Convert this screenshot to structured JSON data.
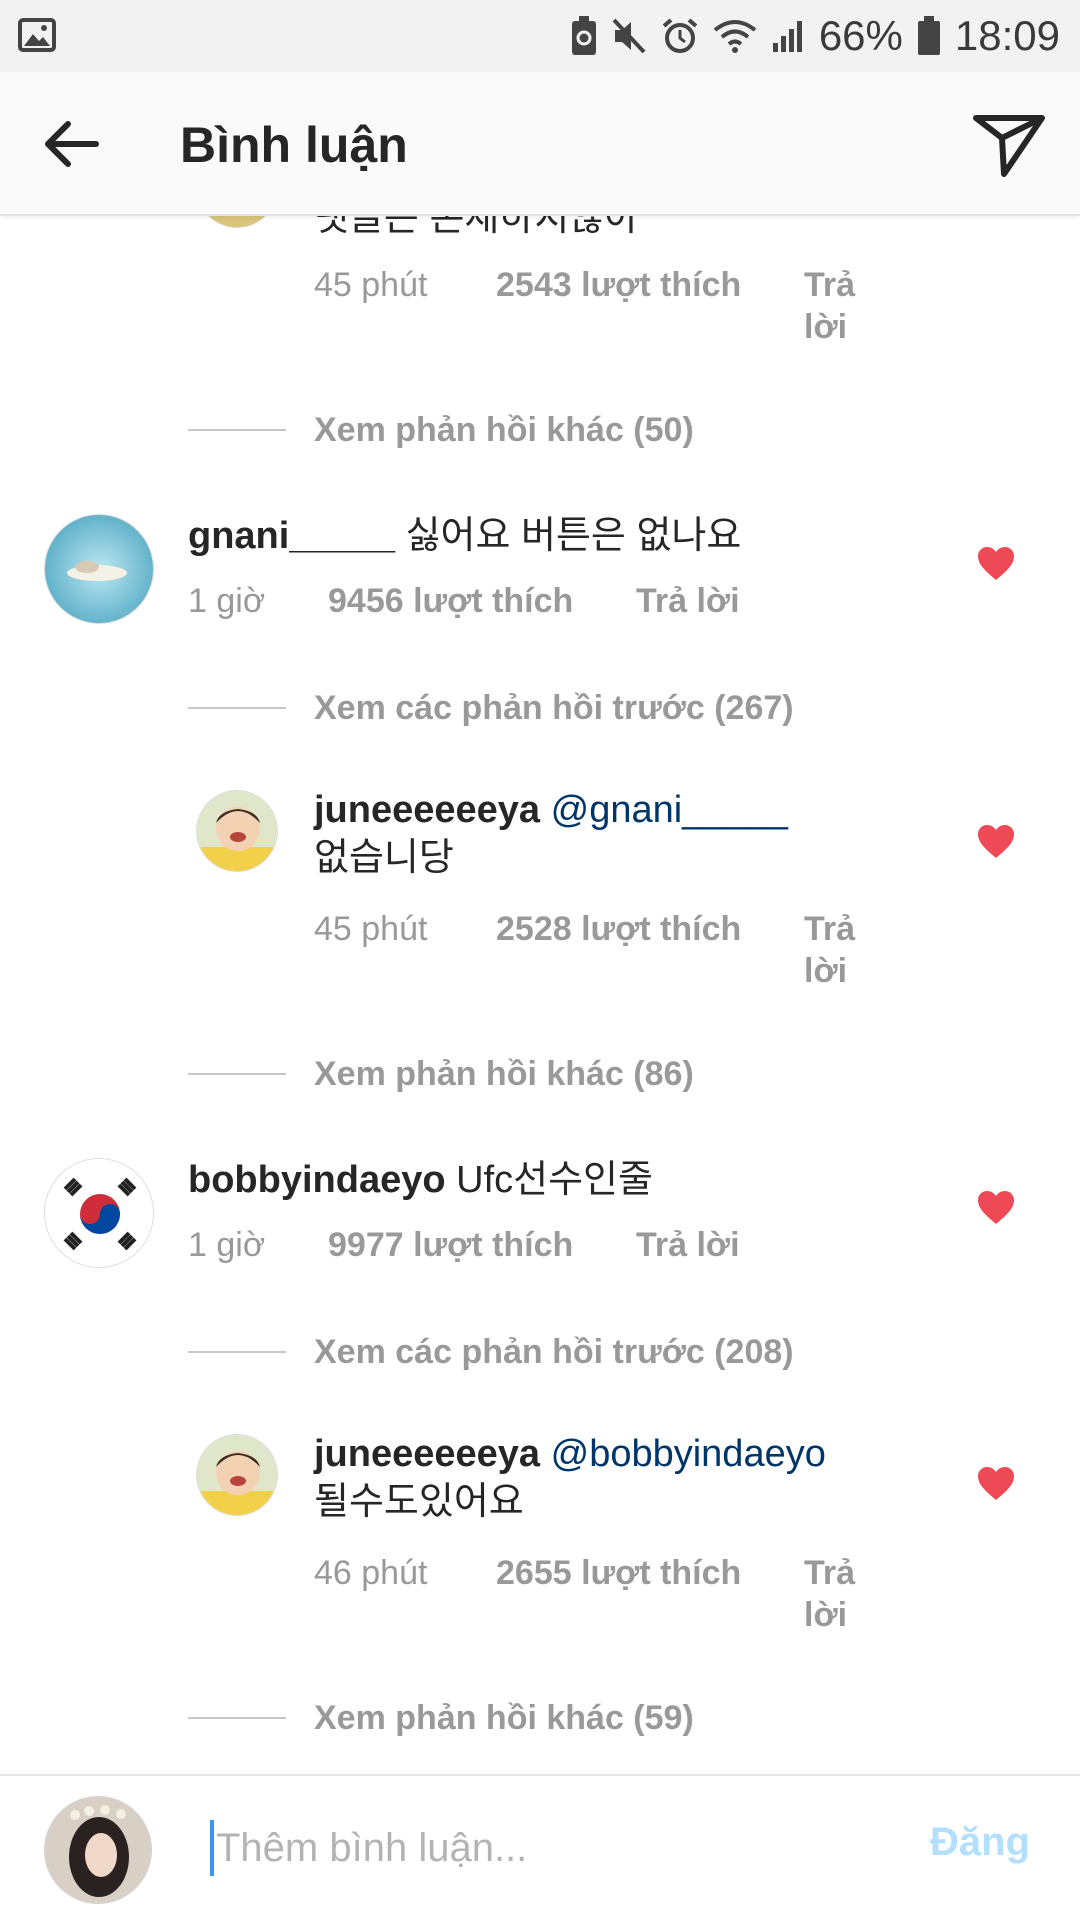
{
  "status_bar": {
    "battery_percent": "66%",
    "time": "18:09",
    "icons": [
      "image-icon",
      "battery-saver-icon",
      "mute-icon",
      "alarm-icon",
      "wifi-icon",
      "signal-icon",
      "battery-icon"
    ]
  },
  "header": {
    "title": "Bình luận",
    "back_icon": "back-arrow-icon",
    "send_icon": "send-icon"
  },
  "comments": {
    "top_partial": {
      "text": "댓글은 존재하지않아",
      "time": "45 phút",
      "likes": "2543 lượt thích",
      "reply": "Trả lời",
      "more": "Xem phản hồi khác (50)"
    },
    "c1": {
      "username": "gnani_____",
      "text": "싫어요 버튼은 없나요",
      "time": "1 giờ",
      "likes": "9456 lượt thích",
      "reply": "Trả lời",
      "prev": "Xem các phản hồi trước (267)",
      "reply1": {
        "username": "juneeeeeeya",
        "mention": "@gnani_____",
        "text": "없습니당",
        "time": "45 phút",
        "likes": "2528 lượt thích",
        "reply": "Trả lời"
      },
      "more": "Xem phản hồi khác (86)"
    },
    "c2": {
      "username": "bobbyindaeyo",
      "text": "Ufc선수인줄",
      "time": "1 giờ",
      "likes": "9977 lượt thích",
      "reply": "Trả lời",
      "prev": "Xem các phản hồi trước (208)",
      "reply1": {
        "username": "juneeeeeeya",
        "mention": "@bobbyindaeyo",
        "text": "될수도있어요",
        "time": "46 phút",
        "likes": "2655 lượt thích",
        "reply": "Trả lời"
      },
      "more": "Xem phản hồi khác (59)"
    }
  },
  "composer": {
    "placeholder": "Thêm bình luận...",
    "value": "",
    "post_label": "Đăng"
  },
  "colors": {
    "heart": "#ed4956",
    "mention": "#003569",
    "muted": "#999999",
    "post_disabled": "#b2dffc",
    "cursor": "#3897f0"
  }
}
